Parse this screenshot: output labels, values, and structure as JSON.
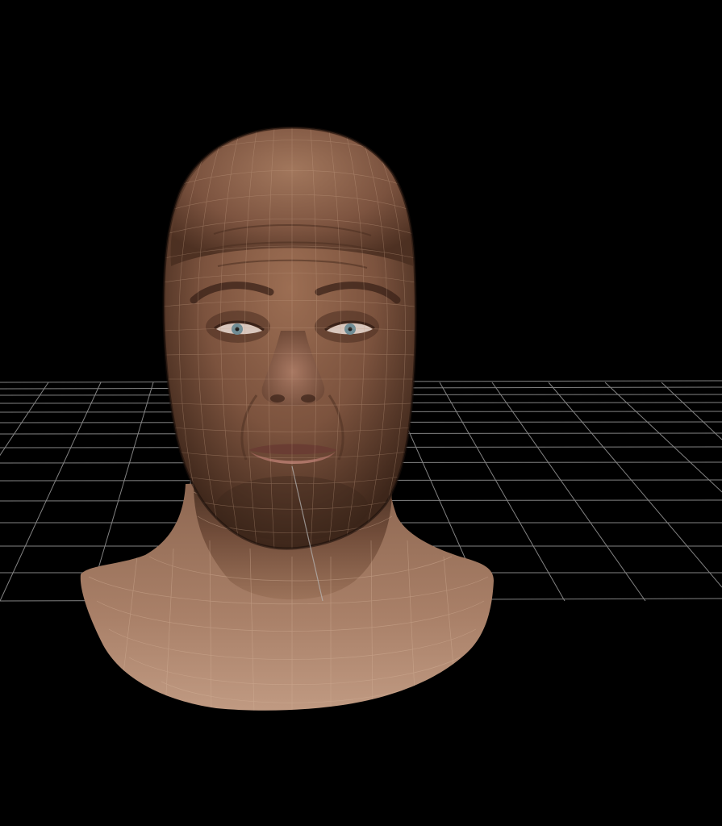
{
  "viewport": {
    "background_color": "#000000",
    "grid_color": "#b8b8b8",
    "skin_base_color": "#8a5f48",
    "skin_highlight_color": "#a87a5e",
    "skin_shadow_color": "#3a2419",
    "wireframe_color": "#caa58a",
    "iris_color": "#6f8c94",
    "lip_color": "#a96a60"
  },
  "scene": {
    "object": "head-mesh",
    "grid_visible": true,
    "wireframe_overlay": true
  }
}
